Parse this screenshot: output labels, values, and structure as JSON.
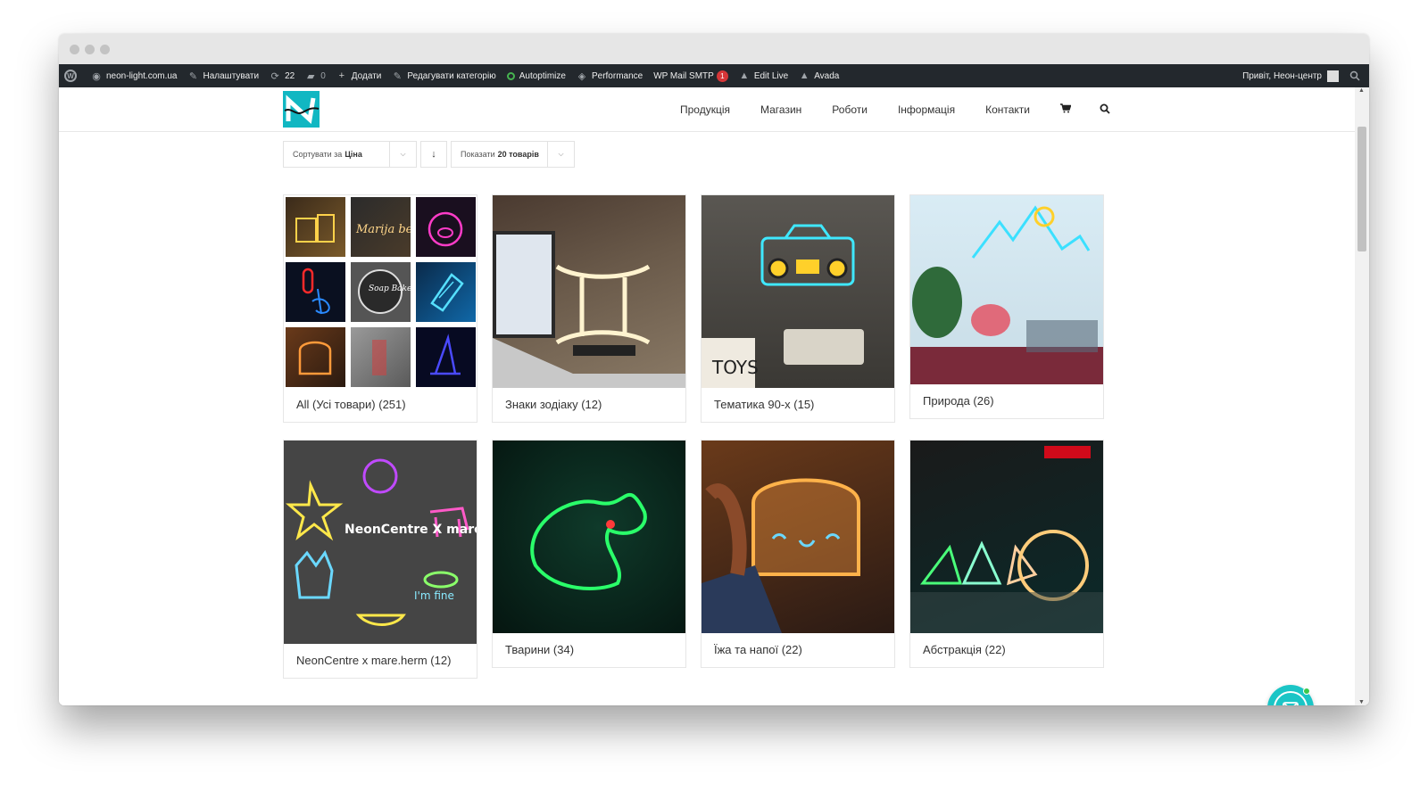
{
  "admin_bar": {
    "site": "neon-light.com.ua",
    "customize": "Налаштувати",
    "updates": "22",
    "comments": "0",
    "new": "Додати",
    "edit_category": "Редагувати категорію",
    "autoptimize": "Autoptimize",
    "performance": "Performance",
    "wp_mail_smtp": "WP Mail SMTP",
    "smtp_badge": "1",
    "edit_live": "Edit Live",
    "avada": "Avada",
    "greeting": "Привіт, Неон-центр"
  },
  "nav": {
    "items": [
      "Продукція",
      "Магазин",
      "Роботи",
      "Інформація",
      "Контакти"
    ]
  },
  "sorting": {
    "sort_prefix": "Сортувати за",
    "sort_value": "Ціна",
    "show_prefix": "Показати",
    "show_value": "20 товарів"
  },
  "categories": [
    {
      "title": "All (Усі товари) (251)"
    },
    {
      "title": "Знаки зодіаку (12)"
    },
    {
      "title": "Тематика 90-х (15)"
    },
    {
      "title": "Природа (26)"
    },
    {
      "title": "NeonCentre x mare.herm (12)"
    },
    {
      "title": "Тварини (34)"
    },
    {
      "title": "Їжа та напої (22)"
    },
    {
      "title": "Абстракція (22)"
    }
  ],
  "image_text": {
    "tile_text": "Marija ben",
    "soap": "Soap Bakery",
    "toys": "TOYS",
    "collab": "NeonCentre X mare.herm",
    "fine": "I'm fine"
  },
  "colors": {
    "admin_bar": "#23282d",
    "brand": "#11b7c2",
    "chat": "#1bc5c6"
  }
}
